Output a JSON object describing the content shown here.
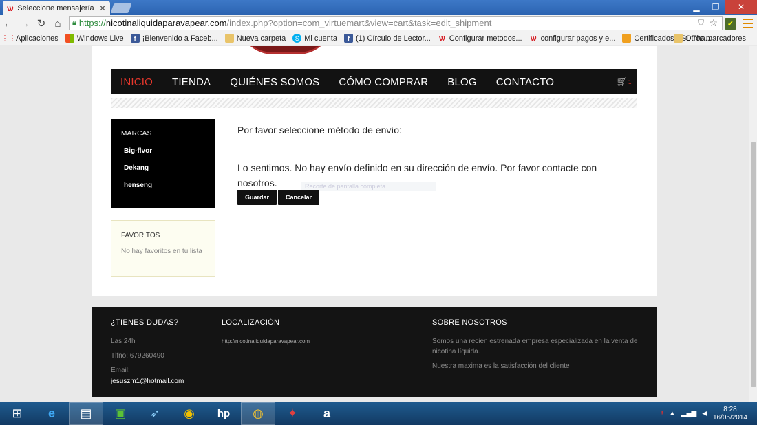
{
  "browser": {
    "tab_title": "Seleccione mensajería",
    "url_https": "https://",
    "url_host": "nicotinaliquidaparavapear.com",
    "url_path": "/index.php?option=com_virtuemart&view=cart&task=edit_shipment",
    "bookmarks": [
      {
        "label": "Aplicaciones",
        "icon": "apps-icon"
      },
      {
        "label": "Windows Live",
        "icon": "windows-live-icon"
      },
      {
        "label": "¡Bienvenido a Faceb...",
        "icon": "facebook-icon"
      },
      {
        "label": "Nueva carpeta",
        "icon": "folder-icon"
      },
      {
        "label": "Mi cuenta",
        "icon": "skype-icon"
      },
      {
        "label": "(1) Círculo de Lector...",
        "icon": "facebook-icon"
      },
      {
        "label": "Configurar metodos...",
        "icon": "site-icon"
      },
      {
        "label": "configurar pagos y e...",
        "icon": "site-icon"
      },
      {
        "label": "Certificados SSL Tha...",
        "icon": "ssl-icon"
      }
    ],
    "other_bookmarks": "Otros marcadores"
  },
  "site": {
    "nav": [
      "INICIO",
      "TIENDA",
      "QUIÉNES SOMOS",
      "CÓMO COMPRAR",
      "BLOG",
      "CONTACTO"
    ],
    "cart_count": "1",
    "brands_title": "MARCAS",
    "brands": [
      "Big-flvor",
      "Dekang",
      "henseng"
    ],
    "favs_title": "FAVORITOS",
    "favs_empty": "No hay favoritos en tu lista",
    "prompt": "Por favor seleccione método de envío:",
    "message": "Lo sentimos. No hay envío definido en su dirección de envío. Por favor contacte con nosotros.",
    "ghost_text": "Recorte de pantalla completa",
    "save_label": "Guardar",
    "cancel_label": "Cancelar",
    "footer": {
      "doubts_title": "¿TIENES DUDAS?",
      "hours": "Las 24h",
      "phone": "Tlfno: 679260490",
      "email_label": "Email:",
      "email": "jesuszm1@hotmail.com",
      "location_title": "LOCALIZACIÓN",
      "location_url": "http://nicotinaliquidaparavapear.com",
      "about_title": "SOBRE NOSOTROS",
      "about_text": "Somos una recien estrenada empresa especializada en la venta de nicotina líquida.",
      "about_text2": "Nuestra maxima es la satisfacción del cliente"
    }
  },
  "taskbar": {
    "time": "8:28",
    "date": "16/05/2014"
  }
}
